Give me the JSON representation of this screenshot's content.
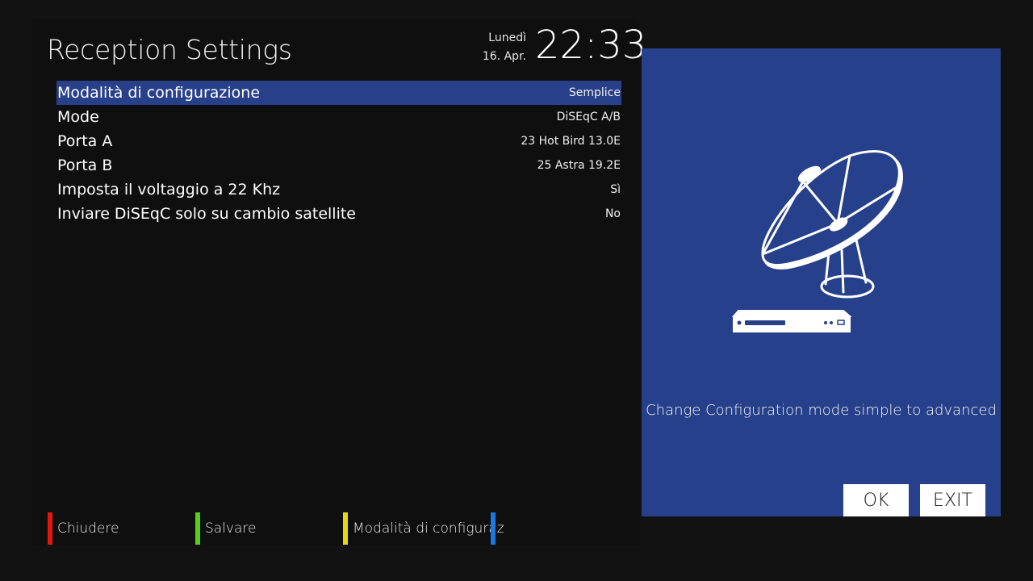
{
  "header": {
    "title": "Reception Settings",
    "day": "Lunedì",
    "date": "16. Apr.",
    "time": "22:33"
  },
  "settings": [
    {
      "label": "Modalità di configurazione",
      "value": "Semplice"
    },
    {
      "label": "Mode",
      "value": "DiSEqC A/B"
    },
    {
      "label": "Porta A",
      "value": "23 Hot Bird 13.0E"
    },
    {
      "label": "Porta B",
      "value": "25 Astra 19.2E"
    },
    {
      "label": "Imposta il voltaggio a 22 Khz",
      "value": "Sì"
    },
    {
      "label": "Inviare DiSEqC solo su cambio satellite",
      "value": "No"
    }
  ],
  "info": {
    "illustration_icon": "satellite-dish-receiver-icon",
    "help_text": "Change Configuration mode simple to advanced",
    "ok_label": "OK",
    "exit_label": "EXIT"
  },
  "color_keys": {
    "red": {
      "label": "Chiudere",
      "color": "#e3170d"
    },
    "green": {
      "label": "Salvare",
      "color": "#55d014"
    },
    "yellow": {
      "label": "Modalità di configuraz",
      "color": "#e8d614"
    },
    "blue": {
      "label": "",
      "color": "#1a78e0"
    }
  },
  "colors": {
    "background": "#121212",
    "selection": "#284089",
    "info_panel": "#27408b"
  }
}
